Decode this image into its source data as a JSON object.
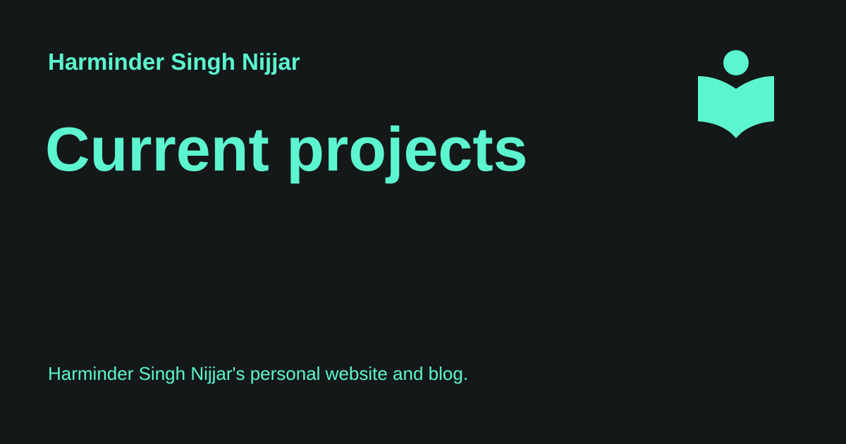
{
  "site_name": "Harminder Singh Nijjar",
  "page_title": "Current projects",
  "description": "Harminder Singh Nijjar's personal website and blog.",
  "logo_icon": "reader-book-icon",
  "colors": {
    "background": "#141819",
    "accent": "#5cf5cf"
  }
}
